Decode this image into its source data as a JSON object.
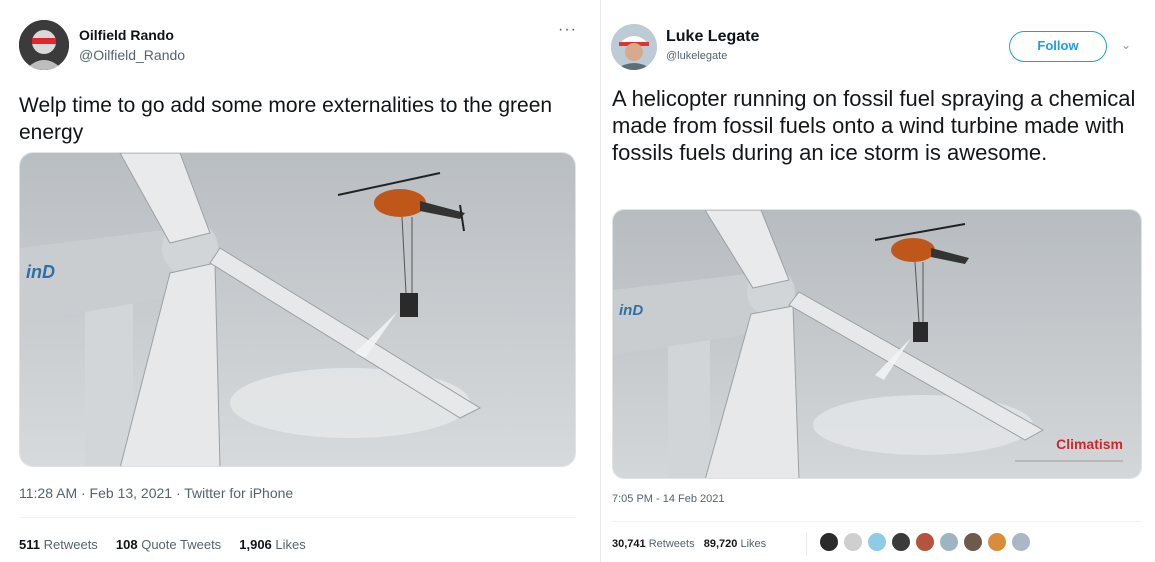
{
  "left_tweet": {
    "author_name": "Oilfield Rando",
    "author_handle": "@Oilfield_Rando",
    "more_icon": "more-horizontal-icon",
    "text": "Welp time to go add some more externalities to the green energy",
    "image_wordmark": "inD",
    "meta": "11:28 AM · Feb 13, 2021 · Twitter for iPhone",
    "stats": {
      "retweets_count": "511",
      "retweets_label": "Retweets",
      "quotes_count": "108",
      "quotes_label": "Quote Tweets",
      "likes_count": "1,906",
      "likes_label": "Likes"
    }
  },
  "right_tweet": {
    "author_name": "Luke Legate",
    "author_handle": "@lukelegate",
    "follow_label": "Follow",
    "chevron_icon": "chevron-down-icon",
    "text": "A helicopter running on fossil fuel spraying a chemical made from fossil fuels onto a wind turbine made with fossils fuels during an ice storm is awesome.",
    "image_wordmark": "inD",
    "watermark": "Climatism",
    "meta": "7:05 PM - 14 Feb 2021",
    "stats": {
      "retweets_count": "30,741",
      "retweets_label": "Retweets",
      "likes_count": "89,720",
      "likes_label": "Likes"
    },
    "liker_colors": [
      "#2b2b2b",
      "#cfcfcf",
      "#8ecbe6",
      "#3a3a3a",
      "#b5533c",
      "#9fb4c2",
      "#6d5a4a",
      "#d98c3c",
      "#a9b8c4"
    ]
  },
  "colors": {
    "accent": "#1d9bf0",
    "text": "#0f1419",
    "secondary": "#536471",
    "watermark": "#d0262a"
  }
}
